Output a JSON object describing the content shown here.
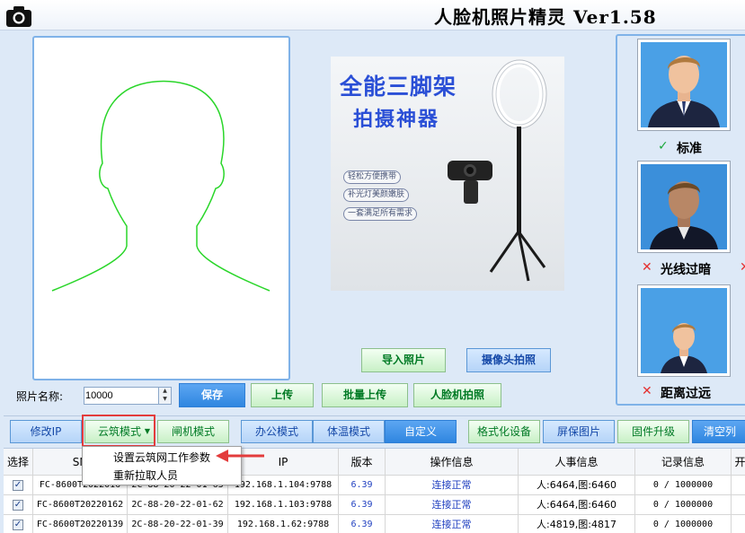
{
  "window": {
    "title": "人脸机照片精灵  Ver1.58"
  },
  "ad": {
    "title_line1": "全能三脚架",
    "title_line2": "拍摄神器",
    "tags": [
      "轻松方便携带",
      "补光灯美颜嫩肤",
      "一套满足所有需求"
    ]
  },
  "import_buttons": {
    "import_photo": "导入照片",
    "camera_capture": "摄像头拍照"
  },
  "photo_name": {
    "label": "照片名称:",
    "value": "10000"
  },
  "action_buttons": {
    "save": "保存",
    "upload": "上传",
    "batch_upload": "批量上传",
    "face_capture": "人脸机拍照"
  },
  "reference": [
    {
      "mark": "✓",
      "label": "标准",
      "color": "#1aa83a"
    },
    {
      "mark": "✕",
      "label": "光线过暗",
      "color": "#e53030"
    },
    {
      "mark": "✕",
      "label": "距离过远",
      "color": "#e53030"
    }
  ],
  "mode_bar": {
    "modify_ip": "修改IP",
    "cloud_mode": "云筑模式",
    "gate_mode": "闸机模式",
    "office_mode": "办公模式",
    "temp_mode": "体温模式",
    "custom": "自定义",
    "format_device": "格式化设备",
    "screensaver": "屏保图片",
    "firmware": "固件升级",
    "clear": "清空列"
  },
  "dropdown_menu": {
    "items": [
      "设置云筑网工作参数",
      "重新拉取人员"
    ]
  },
  "table": {
    "headers": [
      "选择",
      "SN",
      "",
      "IP",
      "版本",
      "操作信息",
      "人事信息",
      "记录信息",
      "开"
    ],
    "rows": [
      {
        "checked": "✓",
        "sn": "FC-8600T2022016",
        "mac": "2C-88-20-22-01-63",
        "ip": "192.168.1.104:9788",
        "version": "6.39",
        "status": "连接正常",
        "person": "人:6464,图:6460",
        "record": "0 / 1000000"
      },
      {
        "checked": "✓",
        "sn": "FC-8600T20220162",
        "mac": "2C-88-20-22-01-62",
        "ip": "192.168.1.103:9788",
        "version": "6.39",
        "status": "连接正常",
        "person": "人:6464,图:6460",
        "record": "0 / 1000000"
      },
      {
        "checked": "✓",
        "sn": "FC-8600T20220139",
        "mac": "2C-88-20-22-01-39",
        "ip": "192.168.1.62:9788",
        "version": "6.39",
        "status": "连接正常",
        "person": "人:4819,图:4817",
        "record": "0 / 1000000"
      }
    ]
  }
}
